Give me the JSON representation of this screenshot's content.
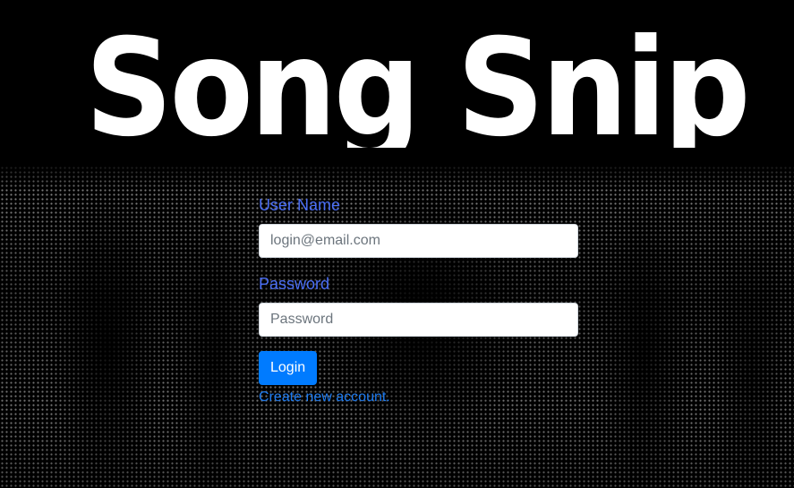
{
  "header": {
    "logo_text": "Song Snip"
  },
  "login_form": {
    "username_label": "User Name",
    "username_placeholder": "login@email.com",
    "username_value": "",
    "password_label": "Password",
    "password_placeholder": "Password",
    "password_value": "",
    "login_button_label": "Login",
    "create_account_link": "Create new account."
  },
  "colors": {
    "background": "#000000",
    "label_color": "#4a6ef5",
    "button_color": "#007bff",
    "link_color": "#1e7cf2"
  }
}
